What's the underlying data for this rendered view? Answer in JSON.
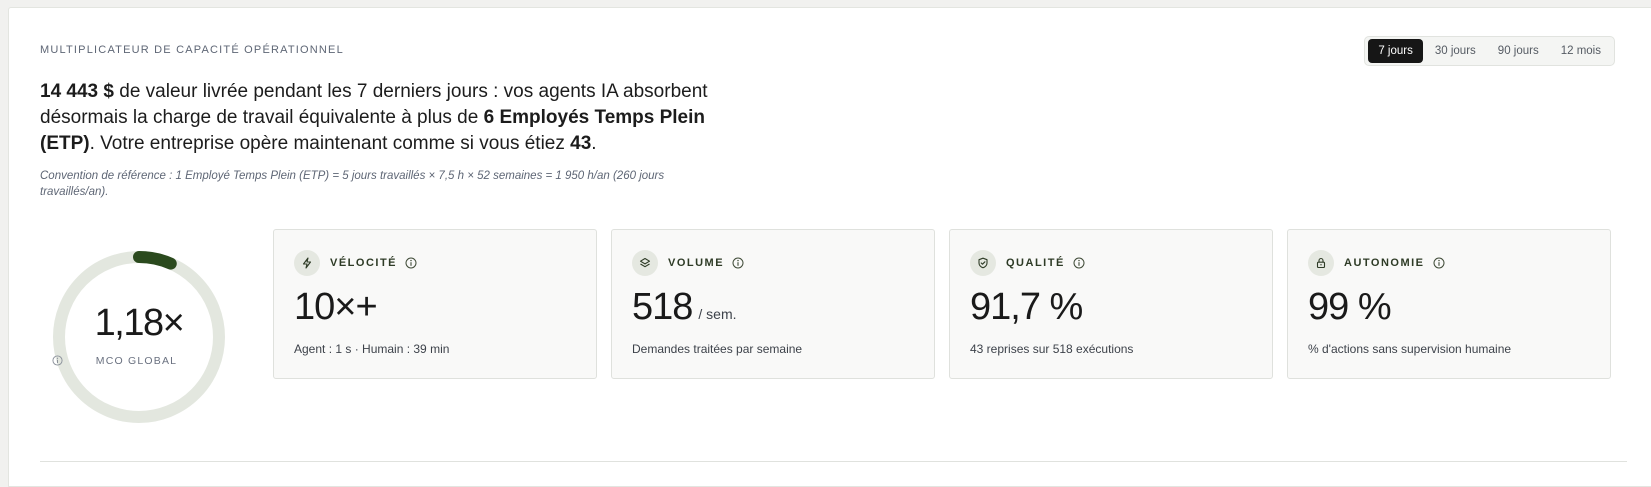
{
  "header": {
    "title": "MULTIPLICATEUR DE CAPACITÉ OPÉRATIONNEL"
  },
  "range": {
    "options": [
      "7 jours",
      "30 jours",
      "90 jours",
      "12 mois"
    ],
    "selected": "7 jours"
  },
  "headline": {
    "amount": "14 443 $",
    "part1": " de valeur livrée pendant les 7 derniers jours : vos agents IA absorbent désormais la charge de travail équivalente à plus de ",
    "etp": "6 Employés Temps Plein (ETP)",
    "part2": ". Votre entreprise opère maintenant comme si vous étiez ",
    "team_size": "43",
    "part3": "."
  },
  "note": "Convention de référence : 1 Employé Temps Plein (ETP) = 5 jours travaillés × 7,5 h × 52 semaines = 1 950 h/an (260 jours travaillés/an).",
  "gauge": {
    "value": "1,18×",
    "label": "MCO GLOBAL",
    "fill_fraction": 0.065,
    "track_color": "#e3e7df",
    "fill_color": "#2b4a1e"
  },
  "cards": [
    {
      "icon": "bolt-icon",
      "title": "VÉLOCITÉ",
      "value": "10×+",
      "unit": "",
      "sub": "Agent : 1 s · Humain : 39 min"
    },
    {
      "icon": "layers-icon",
      "title": "VOLUME",
      "value": "518",
      "unit": "/ sem.",
      "sub": "Demandes traitées par semaine"
    },
    {
      "icon": "shield-check-icon",
      "title": "QUALITÉ",
      "value": "91,7 %",
      "unit": "",
      "sub": "43 reprises sur 518 exécutions"
    },
    {
      "icon": "lock-icon",
      "title": "AUTONOMIE",
      "value": "99 %",
      "unit": "",
      "sub": "% d'actions sans supervision humaine"
    }
  ],
  "colors": {
    "accent": "#2b4a1e",
    "active_tab": "#161616"
  }
}
